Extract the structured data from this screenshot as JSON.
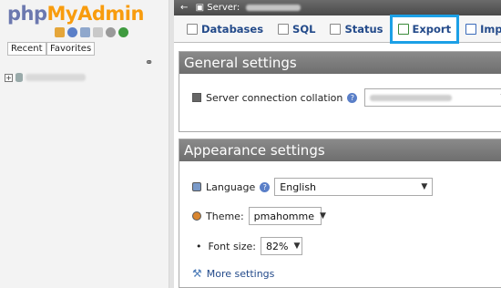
{
  "nav": {
    "logo_php": "php",
    "logo_myadmin": "MyAdmin",
    "recent_label": "Recent",
    "favorites_label": "Favorites"
  },
  "header": {
    "server_label": "Server:"
  },
  "tabs": [
    {
      "label": "Databases",
      "icon": "database-icon"
    },
    {
      "label": "SQL",
      "icon": "sql-icon"
    },
    {
      "label": "Status",
      "icon": "status-icon"
    },
    {
      "label": "Export",
      "icon": "export-icon"
    },
    {
      "label": "Import",
      "icon": "import-icon"
    }
  ],
  "general": {
    "title": "General settings",
    "collation_label": "Server connection collation"
  },
  "appearance": {
    "title": "Appearance settings",
    "language_label": "Language",
    "language_value": "English",
    "theme_label": "Theme:",
    "theme_value": "pmahomme",
    "fontsize_label": "Font size:",
    "fontsize_value": "82%",
    "more_settings": "More settings"
  },
  "colors": {
    "highlight": "#1ca0e6",
    "section_header": "#7a7a7a",
    "link": "#234a8a"
  }
}
